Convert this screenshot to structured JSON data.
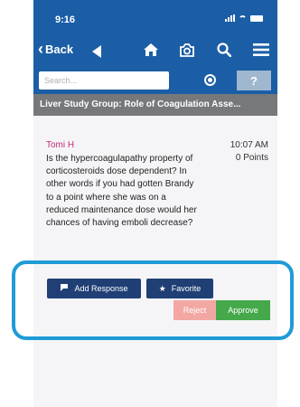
{
  "status": {
    "time": "9:16"
  },
  "nav": {
    "back_label": "Back"
  },
  "search": {
    "placeholder": "Search..."
  },
  "help": {
    "label": "?"
  },
  "title": "Liver Study Group: Role of Coagulation Asse...",
  "post": {
    "author": "Tomi H",
    "time": "10:07 AM",
    "points": "0 Points",
    "body": "Is the hypercoagulapathy property of corticosteroids dose dependent? In other words if you had gotten Brandy to a point where she was on a reduced maintenance dose would her chances of having emboli decrease?"
  },
  "actions": {
    "add_response": "Add Response",
    "favorite": "Favorite",
    "reject": "Reject",
    "approve": "Approve"
  },
  "colors": {
    "header": "#1b5ea6",
    "title_bar": "#77787a",
    "author": "#c3297a",
    "action_button": "#1f3f75",
    "reject": "#f2a7a3",
    "approve": "#45a84a",
    "highlight": "#1f9bd7"
  },
  "icons": [
    "signal-icon",
    "wifi-icon",
    "battery-icon",
    "back-chevron-icon",
    "previous-arrow-icon",
    "home-icon",
    "camera-icon",
    "search-icon",
    "menu-icon",
    "location-target-icon",
    "comment-icon",
    "star-icon"
  ]
}
